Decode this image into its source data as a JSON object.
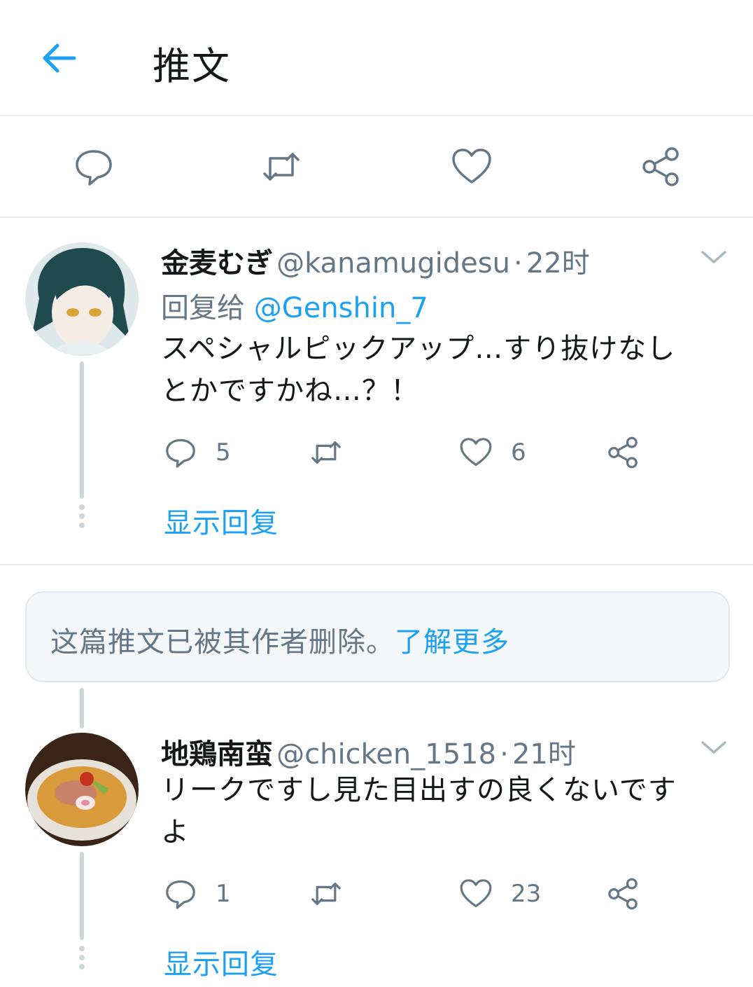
{
  "header": {
    "title": "推文"
  },
  "tweet1": {
    "name": "金麦むぎ",
    "handle": "@kanamugidesu",
    "separator": "·",
    "time": "22时",
    "reply_prefix": "回复给",
    "reply_handle": "@Genshin_7",
    "text_line1": "スペシャルピックアップ…すり抜けなし",
    "text_line2": "とかですかね…？！",
    "reply_count": "5",
    "like_count": "6",
    "show_replies": "显示回复"
  },
  "deleted_notice": {
    "text": "这篇推文已被其作者删除。",
    "link": "了解更多"
  },
  "tweet2": {
    "name": "地鶏南蛮",
    "handle": "@chicken_1518",
    "separator": "·",
    "time": "21时",
    "text_line1": "リークですし見た目出すの良くないです",
    "text_line2": "よ",
    "reply_count": "1",
    "like_count": "23",
    "show_replies": "显示回复"
  },
  "colors": {
    "accent": "#1da1f2",
    "icon_gray": "#657786",
    "line": "#ccd6dd"
  }
}
